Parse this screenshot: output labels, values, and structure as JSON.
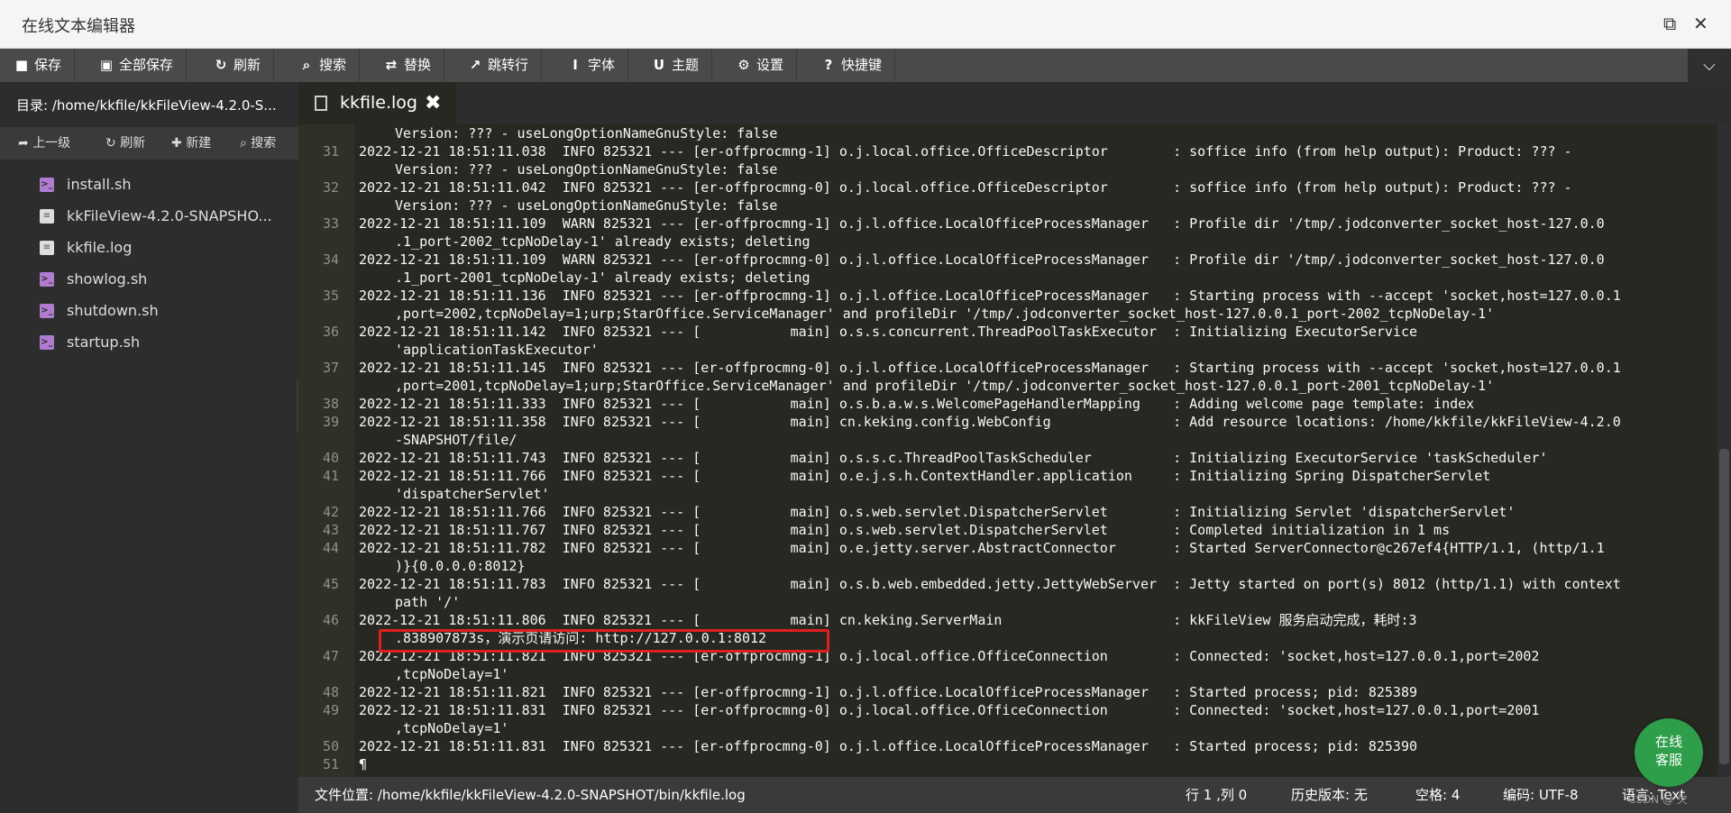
{
  "window": {
    "title": "在线文本编辑器"
  },
  "toolbar": {
    "buttons": [
      {
        "label": "保存",
        "icon": "save-icon"
      },
      {
        "label": "全部保存",
        "icon": "save-all-icon"
      },
      {
        "label": "刷新",
        "icon": "refresh-icon"
      },
      {
        "label": "搜索",
        "icon": "search-icon"
      },
      {
        "label": "替换",
        "icon": "replace-icon"
      },
      {
        "label": "跳转行",
        "icon": "goto-line-icon"
      },
      {
        "label": "字体",
        "icon": "font-icon"
      },
      {
        "label": "主题",
        "icon": "theme-icon"
      },
      {
        "label": "设置",
        "icon": "gear-icon"
      },
      {
        "label": "快捷键",
        "icon": "help-icon"
      }
    ]
  },
  "sidebar": {
    "path": "目录: /home/kkfile/kkFileView-4.2.0-S...",
    "actions": [
      {
        "label": "上一级",
        "icon": "arrow-up-icon"
      },
      {
        "label": "刷新",
        "icon": "refresh-icon"
      },
      {
        "label": "新建",
        "icon": "plus-icon"
      },
      {
        "label": "搜索",
        "icon": "search-icon"
      }
    ],
    "files": [
      {
        "name": "install.sh",
        "type": "sh"
      },
      {
        "name": "kkFileView-4.2.0-SNAPSHO...",
        "type": "doc"
      },
      {
        "name": "kkfile.log",
        "type": "doc"
      },
      {
        "name": "showlog.sh",
        "type": "sh"
      },
      {
        "name": "shutdown.sh",
        "type": "sh"
      },
      {
        "name": "startup.sh",
        "type": "sh"
      }
    ]
  },
  "tab": {
    "label": "kkfile.log",
    "close": "✖"
  },
  "editor": {
    "lines": [
      {
        "ln": "",
        "text": "Version: ??? - useLongOptionNameGnuStyle: false",
        "indent": true
      },
      {
        "ln": "31",
        "text": "2022-12-21 18:51:11.038  INFO 825321 --- [er-offprocmng-1] o.j.local.office.OfficeDescriptor        : soffice info (from help output): Product: ??? -",
        "indent": false
      },
      {
        "ln": "",
        "text": "Version: ??? - useLongOptionNameGnuStyle: false",
        "indent": true
      },
      {
        "ln": "32",
        "text": "2022-12-21 18:51:11.042  INFO 825321 --- [er-offprocmng-0] o.j.local.office.OfficeDescriptor        : soffice info (from help output): Product: ??? -",
        "indent": false
      },
      {
        "ln": "",
        "text": "Version: ??? - useLongOptionNameGnuStyle: false",
        "indent": true
      },
      {
        "ln": "33",
        "text": "2022-12-21 18:51:11.109  WARN 825321 --- [er-offprocmng-1] o.j.l.office.LocalOfficeProcessManager   : Profile dir '/tmp/.jodconverter_socket_host-127.0.0",
        "indent": false
      },
      {
        "ln": "",
        "text": ".1_port-2002_tcpNoDelay-1' already exists; deleting",
        "indent": true
      },
      {
        "ln": "34",
        "text": "2022-12-21 18:51:11.109  WARN 825321 --- [er-offprocmng-0] o.j.l.office.LocalOfficeProcessManager   : Profile dir '/tmp/.jodconverter_socket_host-127.0.0",
        "indent": false
      },
      {
        "ln": "",
        "text": ".1_port-2001_tcpNoDelay-1' already exists; deleting",
        "indent": true
      },
      {
        "ln": "35",
        "text": "2022-12-21 18:51:11.136  INFO 825321 --- [er-offprocmng-1] o.j.l.office.LocalOfficeProcessManager   : Starting process with --accept 'socket,host=127.0.0.1",
        "indent": false
      },
      {
        "ln": "",
        "text": ",port=2002,tcpNoDelay=1;urp;StarOffice.ServiceManager' and profileDir '/tmp/.jodconverter_socket_host-127.0.0.1_port-2002_tcpNoDelay-1'",
        "indent": true
      },
      {
        "ln": "36",
        "text": "2022-12-21 18:51:11.142  INFO 825321 --- [           main] o.s.s.concurrent.ThreadPoolTaskExecutor  : Initializing ExecutorService",
        "indent": false
      },
      {
        "ln": "",
        "text": "'applicationTaskExecutor'",
        "indent": true
      },
      {
        "ln": "37",
        "text": "2022-12-21 18:51:11.145  INFO 825321 --- [er-offprocmng-0] o.j.l.office.LocalOfficeProcessManager   : Starting process with --accept 'socket,host=127.0.0.1",
        "indent": false
      },
      {
        "ln": "",
        "text": ",port=2001,tcpNoDelay=1;urp;StarOffice.ServiceManager' and profileDir '/tmp/.jodconverter_socket_host-127.0.0.1_port-2001_tcpNoDelay-1'",
        "indent": true
      },
      {
        "ln": "38",
        "text": "2022-12-21 18:51:11.333  INFO 825321 --- [           main] o.s.b.a.w.s.WelcomePageHandlerMapping    : Adding welcome page template: index",
        "indent": false
      },
      {
        "ln": "39",
        "text": "2022-12-21 18:51:11.358  INFO 825321 --- [           main] cn.keking.config.WebConfig               : Add resource locations: /home/kkfile/kkFileView-4.2.0",
        "indent": false
      },
      {
        "ln": "",
        "text": "-SNAPSHOT/file/",
        "indent": true
      },
      {
        "ln": "40",
        "text": "2022-12-21 18:51:11.743  INFO 825321 --- [           main] o.s.s.c.ThreadPoolTaskScheduler          : Initializing ExecutorService 'taskScheduler'",
        "indent": false
      },
      {
        "ln": "41",
        "text": "2022-12-21 18:51:11.766  INFO 825321 --- [           main] o.e.j.s.h.ContextHandler.application     : Initializing Spring DispatcherServlet",
        "indent": false
      },
      {
        "ln": "",
        "text": "'dispatcherServlet'",
        "indent": true
      },
      {
        "ln": "42",
        "text": "2022-12-21 18:51:11.766  INFO 825321 --- [           main] o.s.web.servlet.DispatcherServlet        : Initializing Servlet 'dispatcherServlet'",
        "indent": false
      },
      {
        "ln": "43",
        "text": "2022-12-21 18:51:11.767  INFO 825321 --- [           main] o.s.web.servlet.DispatcherServlet        : Completed initialization in 1 ms",
        "indent": false
      },
      {
        "ln": "44",
        "text": "2022-12-21 18:51:11.782  INFO 825321 --- [           main] o.e.jetty.server.AbstractConnector       : Started ServerConnector@c267ef4{HTTP/1.1, (http/1.1",
        "indent": false
      },
      {
        "ln": "",
        "text": ")}{0.0.0.0:8012}",
        "indent": true
      },
      {
        "ln": "45",
        "text": "2022-12-21 18:51:11.783  INFO 825321 --- [           main] o.s.b.web.embedded.jetty.JettyWebServer  : Jetty started on port(s) 8012 (http/1.1) with context",
        "indent": false
      },
      {
        "ln": "",
        "text": "path '/'",
        "indent": true
      },
      {
        "ln": "46",
        "text": "2022-12-21 18:51:11.806  INFO 825321 --- [           main] cn.keking.ServerMain                     : kkFileView 服务启动完成，耗时:3",
        "indent": false
      },
      {
        "ln": "",
        "text": ".838907873s，演示页请访问: http://127.0.0.1:8012",
        "indent": true
      },
      {
        "ln": "47",
        "text": "2022-12-21 18:51:11.821  INFO 825321 --- [er-offprocmng-1] o.j.local.office.OfficeConnection        : Connected: 'socket,host=127.0.0.1,port=2002",
        "indent": false
      },
      {
        "ln": "",
        "text": ",tcpNoDelay=1'",
        "indent": true
      },
      {
        "ln": "48",
        "text": "2022-12-21 18:51:11.821  INFO 825321 --- [er-offprocmng-1] o.j.l.office.LocalOfficeProcessManager   : Started process; pid: 825389",
        "indent": false
      },
      {
        "ln": "49",
        "text": "2022-12-21 18:51:11.831  INFO 825321 --- [er-offprocmng-0] o.j.local.office.OfficeConnection        : Connected: 'socket,host=127.0.0.1,port=2001",
        "indent": false
      },
      {
        "ln": "",
        "text": ",tcpNoDelay=1'",
        "indent": true
      },
      {
        "ln": "50",
        "text": "2022-12-21 18:51:11.831  INFO 825321 --- [er-offprocmng-0] o.j.l.office.LocalOfficeProcessManager   : Started process; pid: 825390",
        "indent": false
      },
      {
        "ln": "51",
        "text": "¶",
        "indent": false
      }
    ]
  },
  "statusbar": {
    "file_path": "文件位置: /home/kkfile/kkFileView-4.2.0-SNAPSHOT/bin/kkfile.log",
    "cursor": "行 1 ,列 0",
    "history": "历史版本: 无",
    "indent": "空格: 4",
    "encoding": "编码: UTF-8",
    "language": "语言: Text"
  },
  "chat": {
    "line1": "在线",
    "line2": "客服"
  },
  "watermark": "CSDN @ 欠"
}
